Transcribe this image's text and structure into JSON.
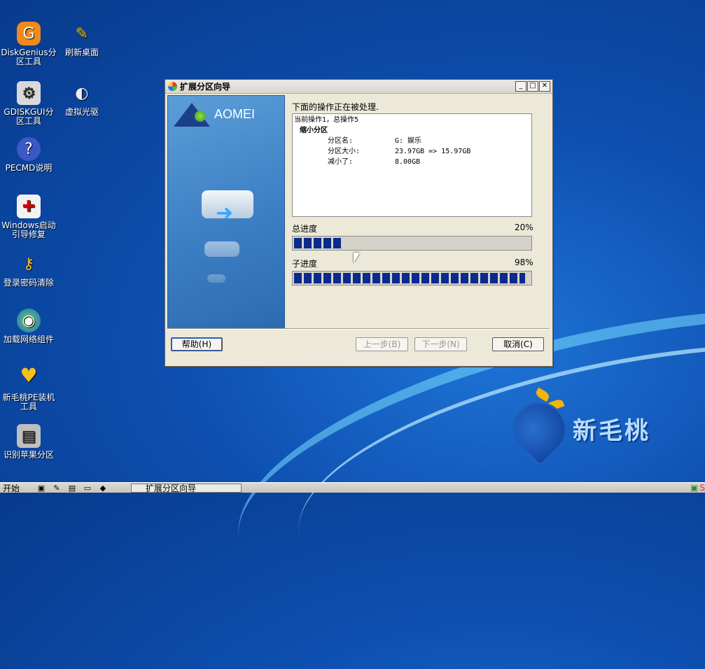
{
  "desktop": {
    "icons": [
      {
        "label": "DiskGenius分区工具",
        "icon": "diskgenius-icon"
      },
      {
        "label": "刷新桌面",
        "icon": "refresh-desktop-icon"
      },
      {
        "label": "GDISKGUI分区工具",
        "icon": "gdisk-icon"
      },
      {
        "label": "虚拟光驱",
        "icon": "virtual-drive-icon"
      },
      {
        "label": "PECMD说明",
        "icon": "help-icon"
      },
      {
        "label": "Windows启动引导修复",
        "icon": "boot-repair-icon"
      },
      {
        "label": "登录密码清除",
        "icon": "key-icon"
      },
      {
        "label": "加载网络组件",
        "icon": "network-icon"
      },
      {
        "label": "新毛桃PE装机工具",
        "icon": "peach-icon"
      },
      {
        "label": "识别苹果分区",
        "icon": "apple-partition-icon"
      }
    ],
    "brand_text": "新毛桃"
  },
  "dialog": {
    "title": "扩展分区向导",
    "brand": "AOMEI",
    "op_label": "下面的操作正在被处理.",
    "op_lines": {
      "current": "当前操作1，总操作5",
      "section": "缩小分区",
      "rows": [
        {
          "key": "分区名:",
          "value": "G: 娱乐"
        },
        {
          "key": "分区大小:",
          "value": "23.97GB => 15.97GB"
        },
        {
          "key": "减小了:",
          "value": "8.00GB"
        }
      ]
    },
    "total_progress": {
      "label": "总进度",
      "text": "20%",
      "value": 0.2
    },
    "sub_progress": {
      "label": "子进度",
      "text": "98%",
      "value": 0.98
    },
    "buttons": {
      "help": "帮助(H)",
      "prev": "上一步(B)",
      "next": "下一步(N)",
      "cancel": "取消(C)"
    }
  },
  "taskbar": {
    "start": "开始",
    "task": "扩展分区向导"
  }
}
